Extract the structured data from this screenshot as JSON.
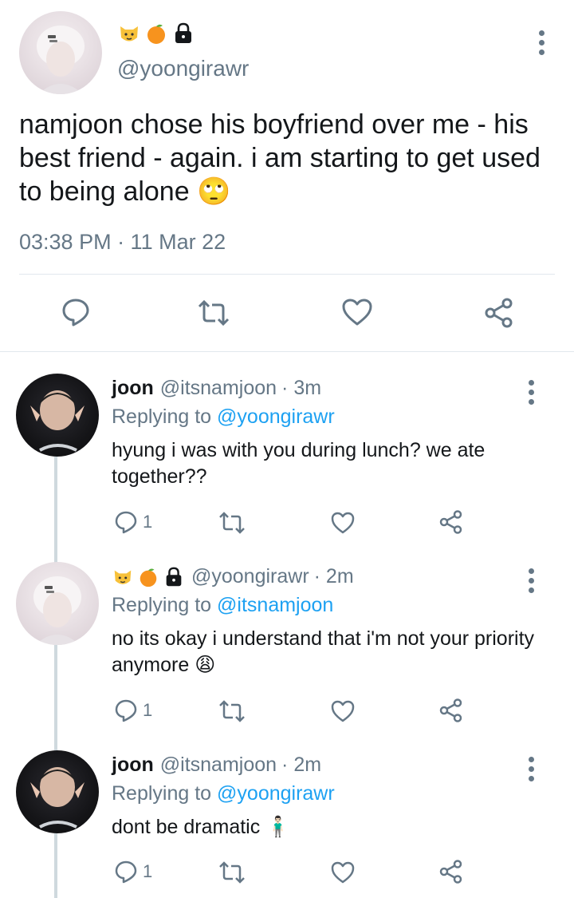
{
  "main_tweet": {
    "display_emojis": [
      "cat-face",
      "tangerine",
      "locked"
    ],
    "handle": "@yoongirawr",
    "text": "namjoon chose his boyfriend over me - his best friend - again. i am starting to get used to being alone 🙄",
    "timestamp": "03:38 PM · 11 Mar 22"
  },
  "replies": [
    {
      "name": "joon",
      "handle": "@itsnamjoon",
      "time": "· 3m",
      "replying_prefix": "Replying to",
      "replying_to": "@yoongirawr",
      "text": "hyung i was with you during lunch? we ate together??",
      "reply_count": "1"
    },
    {
      "display_emojis": [
        "cat-face",
        "tangerine",
        "locked"
      ],
      "handle": "@yoongirawr",
      "time": "· 2m",
      "replying_prefix": "Replying to",
      "replying_to": "@itsnamjoon",
      "text": "no its okay i understand that i'm not your priority anymore 😩",
      "reply_count": "1"
    },
    {
      "name": "joon",
      "handle": "@itsnamjoon",
      "time": "· 2m",
      "replying_prefix": "Replying to",
      "replying_to": "@yoongirawr",
      "text": "dont be dramatic 🧍🏻‍♂️",
      "reply_count": "1"
    }
  ],
  "colors": {
    "link": "#1da1f2",
    "secondary_text": "#657786",
    "divider": "#e1e8ed",
    "thread_line": "#cfd9de"
  },
  "icons": [
    "reply-icon",
    "retweet-icon",
    "like-icon",
    "share-icon",
    "more-icon"
  ]
}
